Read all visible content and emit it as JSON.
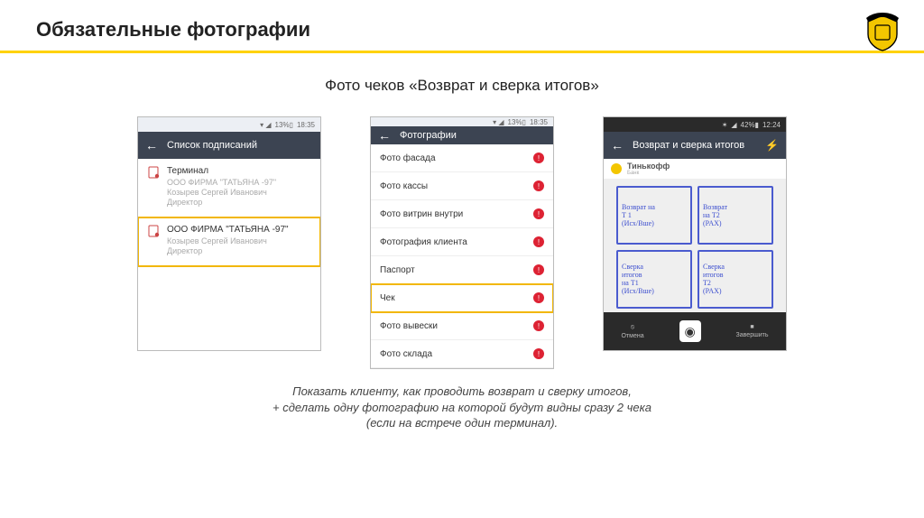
{
  "title": "Обязательные фотографии",
  "subtitle": "Фото чеков «Возврат и сверка итогов»",
  "footer": {
    "line1": "Показать клиенту, как проводить возврат и сверку итогов,",
    "line2": "+ сделать одну фотографию на которой будут видны сразу 2 чека",
    "line3": "(если на встрече один терминал)."
  },
  "phone1": {
    "status": {
      "signal": "▾ ◢",
      "battery": "13%▯",
      "time": "18:35"
    },
    "appbar": "Список подписаний",
    "items": [
      {
        "title": "Терминал",
        "l1": "ООО ФИРМА \"ТАТЬЯНА -97\"",
        "l2": "Козырев Сергей Иванович",
        "l3": "Директор",
        "hl": false
      },
      {
        "title": "ООО ФИРМА \"ТАТЬЯНА -97\"",
        "l1": "Козырев Сергей Иванович",
        "l2": "Директор",
        "l3": "",
        "hl": true
      }
    ]
  },
  "phone2": {
    "status": {
      "signal": "▾ ◢",
      "battery": "13%▯",
      "time": "18:35"
    },
    "appbar": "Фотографии",
    "items": [
      {
        "label": "Фото фасада",
        "hl": false
      },
      {
        "label": "Фото кассы",
        "hl": false
      },
      {
        "label": "Фото витрин внутри",
        "hl": false
      },
      {
        "label": "Фотография клиента",
        "hl": false
      },
      {
        "label": "Паспорт",
        "hl": false
      },
      {
        "label": "Чек",
        "hl": true
      },
      {
        "label": "Фото вывески",
        "hl": false
      },
      {
        "label": "Фото склада",
        "hl": false
      }
    ]
  },
  "phone3": {
    "status": {
      "signal": "◢",
      "battery": "42%▮",
      "time": "12:24"
    },
    "appbar": "Возврат и сверка итогов",
    "brand": "Тинькофф",
    "brand_sub": "Банк",
    "receipts": [
      {
        "l1": "Возврат на",
        "l2": "Т 1",
        "l3": "(Исх/Вше)"
      },
      {
        "l1": "Возврат",
        "l2": "на Т2",
        "l3": "(PAX)"
      },
      {
        "l1": "Сверка",
        "l2": "итогов",
        "l3": "на Т1",
        "l4": "(Исх/Вше)"
      },
      {
        "l1": "Сверка",
        "l2": "итогов",
        "l3": "Т2",
        "l4": "(PAX)"
      }
    ],
    "cam": {
      "left": "Отмена",
      "right": "Завершить"
    }
  }
}
